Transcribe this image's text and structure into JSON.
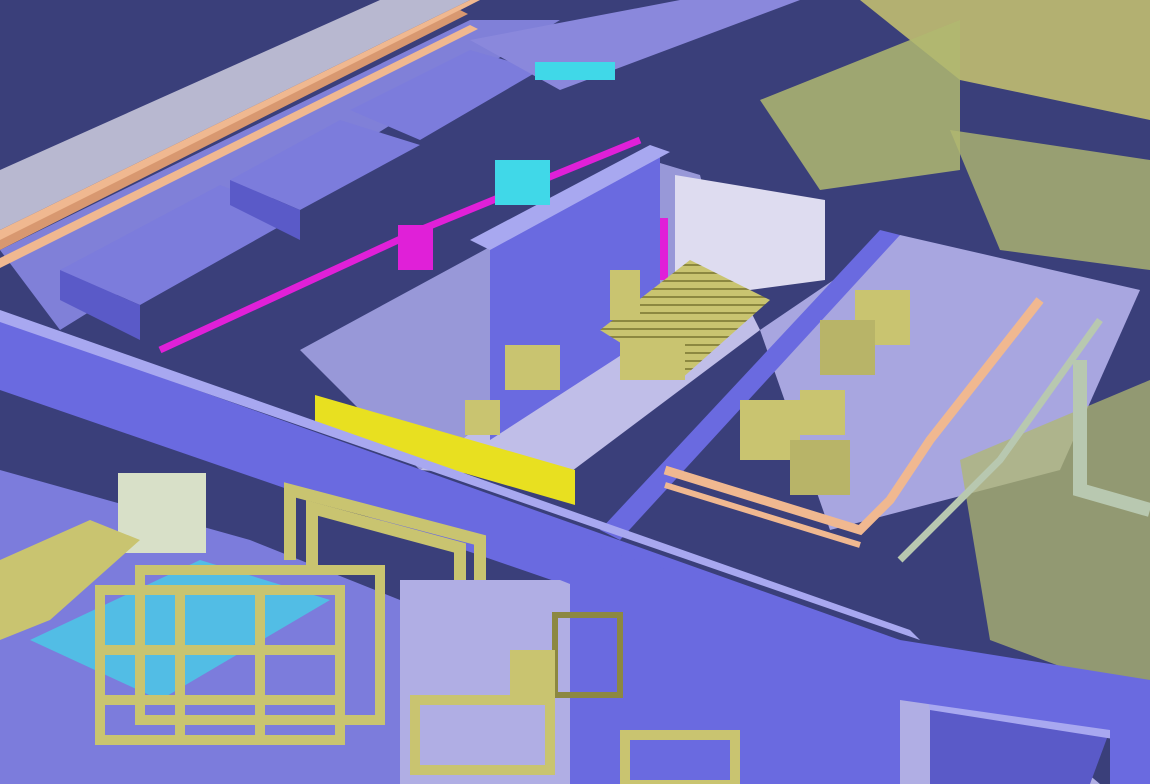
{
  "scene": {
    "kind": "3D CAD plant layout render",
    "palette": {
      "background": "#3a3f7a",
      "wall": "#6a6ae0",
      "wall_light": "#8f8fe8",
      "wall_dark": "#4a4ab8",
      "floor": "#9a98d8",
      "floor_light": "#c9c7ee",
      "equipment": "#c9c470",
      "equipment_dark": "#8c8840",
      "equipment_light": "#e2df9a",
      "pipe_magenta": "#e020d8",
      "pipe_peach": "#f0b890",
      "pipe_cyan": "#40d8e8",
      "pipe_gray": "#b8c8b0",
      "cabinet_yellow": "#e8e020",
      "glass_room": "#b0b870"
    }
  }
}
